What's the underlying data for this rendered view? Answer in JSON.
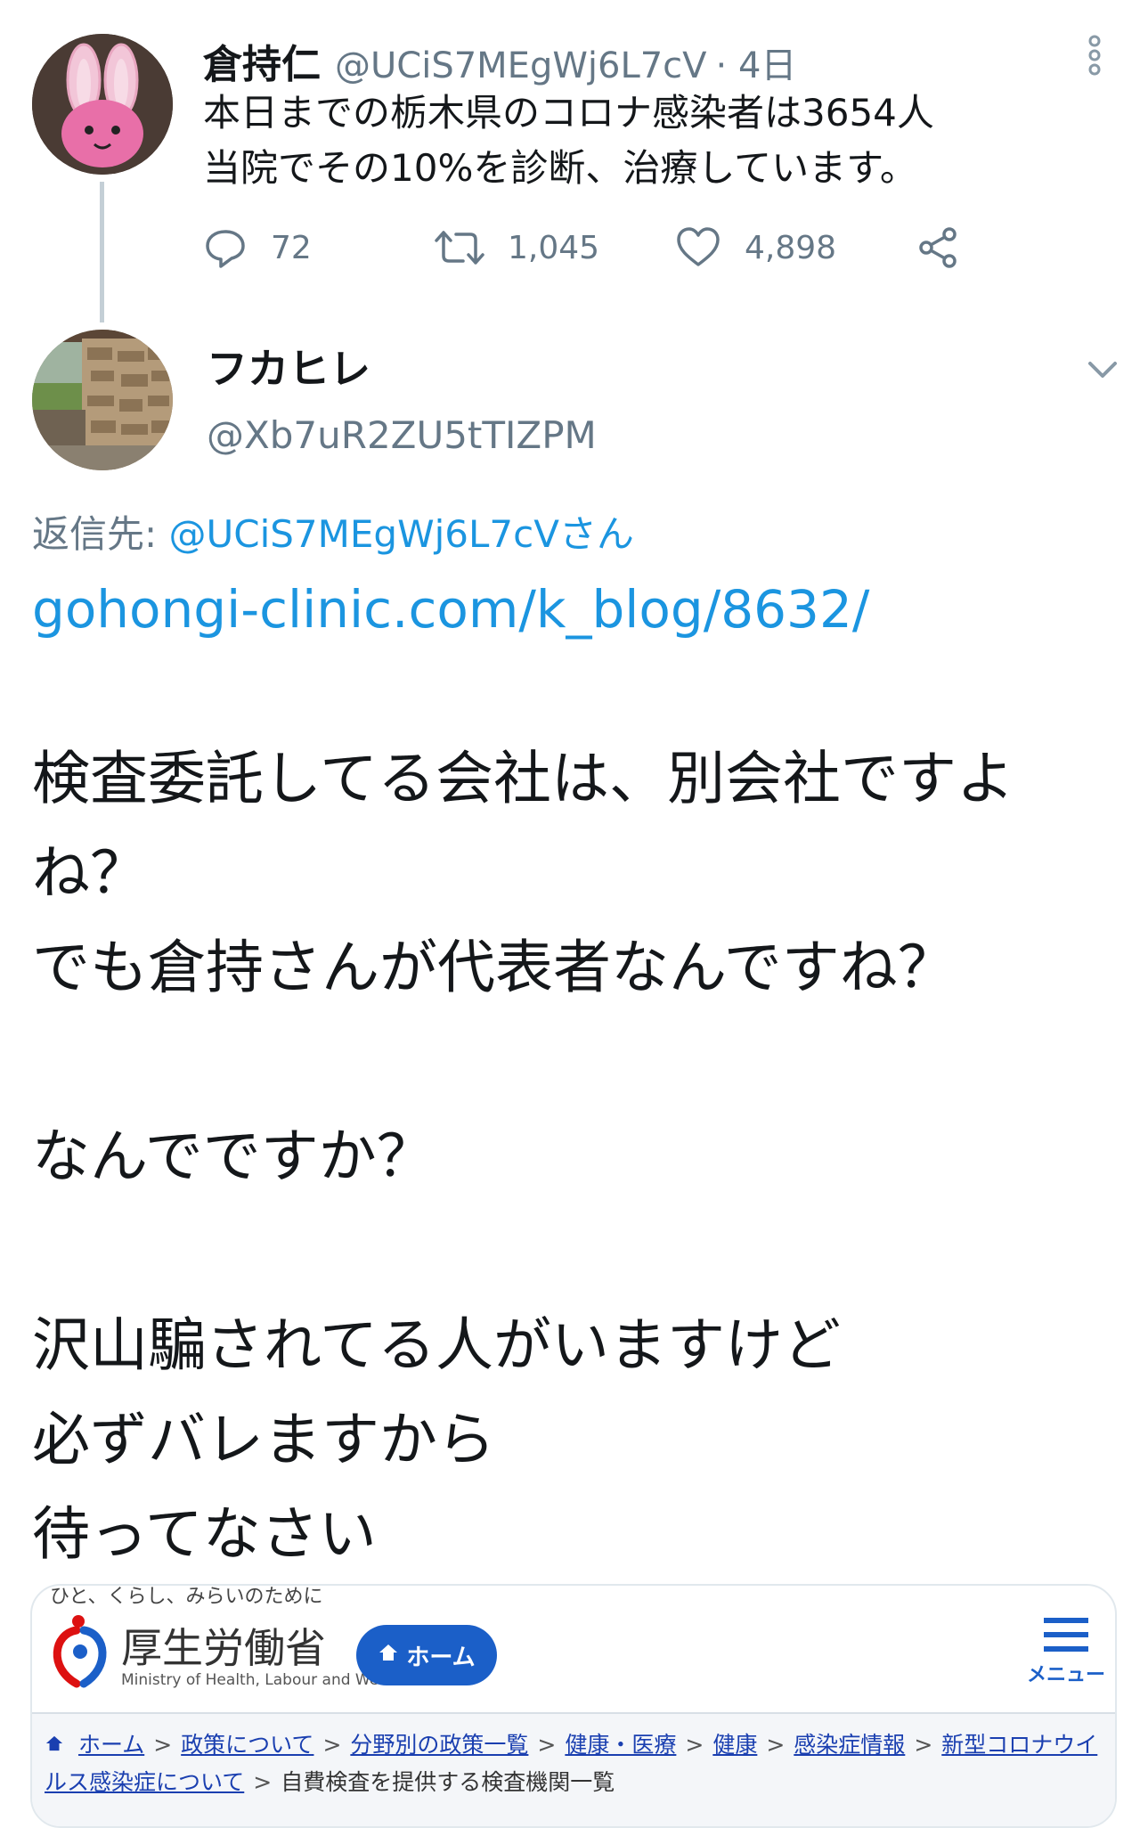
{
  "parent_tweet": {
    "display_name": "倉持仁",
    "handle": "@UCiS7MEgWj6L7cV",
    "time": "· 4日",
    "text": "本日までの栃木県のコロナ感染者は3654人\n当院でその10%を診断、治療しています。",
    "replies": "72",
    "retweets": "1,045",
    "likes": "4,898"
  },
  "reply_tweet": {
    "display_name": "フカヒレ",
    "handle": "@Xb7uR2ZU5tTIZPM",
    "reply_to_label": "返信先: ",
    "reply_to_handle": "@UCiS7MEgWj6L7cVさん",
    "link": "gohongi-clinic.com/k_blog/8632/",
    "body": "検査委託してる会社は、別会社ですよ\nね？\nでも倉持さんが代表者なんですね？\n\nなんでですか？\n\n沢山騙されてる人がいますけど\n必ずバレますから\n待ってなさい"
  },
  "embedded_page": {
    "tagline": "ひと、くらし、みらいのために",
    "ministry_name": "厚生労働省",
    "ministry_en": "Ministry of Health, Labour and Welfare",
    "home_button": "ホーム",
    "menu_label": "メニュー",
    "breadcrumb": {
      "items": [
        "ホーム",
        "政策について",
        "分野別の政策一覧",
        "健康・医療",
        "健康",
        "感染症情報",
        "新型コロナウイルス感染症について"
      ],
      "current": "自費検査を提供する検査機関一覧"
    }
  },
  "colors": {
    "link": "#1b95e0",
    "muted": "#657786",
    "ministry_blue": "#1b5fc8"
  }
}
